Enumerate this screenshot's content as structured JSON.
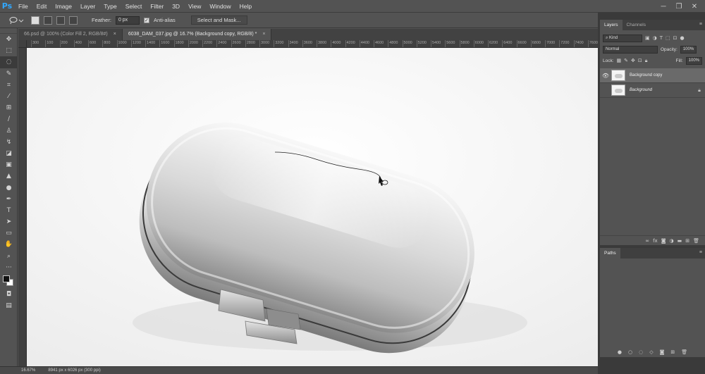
{
  "app": {
    "logo": "Ps"
  },
  "menu": [
    "File",
    "Edit",
    "Image",
    "Layer",
    "Type",
    "Select",
    "Filter",
    "3D",
    "View",
    "Window",
    "Help"
  ],
  "window_controls": [
    "─",
    "❐",
    "✕"
  ],
  "options": {
    "tool_preset_icon": "lasso-icon",
    "feather_label": "Feather:",
    "feather_value": "0 px",
    "antialias_label": "Anti-alias",
    "select_mask_label": "Select and Mask..."
  },
  "tabs": [
    {
      "label": "66.psd @ 100% (Color Fill 2, RGB/8#)",
      "close": "×"
    },
    {
      "label": "6038_DAM_037.jpg @ 16.7% (Background copy, RGB/8) *",
      "close": "×"
    }
  ],
  "ruler_ticks": [
    "300",
    "100",
    "200",
    "400",
    "600",
    "800",
    "1000",
    "1200",
    "1400",
    "1600",
    "1800",
    "2000",
    "2200",
    "2400",
    "2600",
    "2800",
    "3000",
    "3200",
    "3400",
    "3600",
    "3800",
    "4000",
    "4200",
    "4400",
    "4600",
    "4800",
    "5000",
    "5200",
    "5400",
    "5600",
    "5800",
    "6000",
    "6200",
    "6400",
    "6600",
    "6800",
    "7000",
    "7200",
    "7400",
    "7600"
  ],
  "status": {
    "zoom": "16.67%",
    "doc_info": "8941 px x 6026 px (300 ppi)"
  },
  "layers_panel": {
    "tabs": [
      "Layers",
      "Channels"
    ],
    "filter_label": "Kind",
    "blend_mode": "Normal",
    "opacity_label": "Opacity:",
    "opacity_value": "100%",
    "lock_label": "Lock:",
    "fill_label": "Fill:",
    "fill_value": "100%",
    "layers": [
      {
        "name": "Background copy",
        "visible": true,
        "active": true,
        "locked": false
      },
      {
        "name": "Background",
        "visible": false,
        "active": false,
        "locked": true
      }
    ]
  },
  "paths_panel": {
    "title": "Paths"
  },
  "colors": {
    "ui_bg": "#535353",
    "canvas": "#f7f7f7",
    "accent": "#31a8ff"
  }
}
